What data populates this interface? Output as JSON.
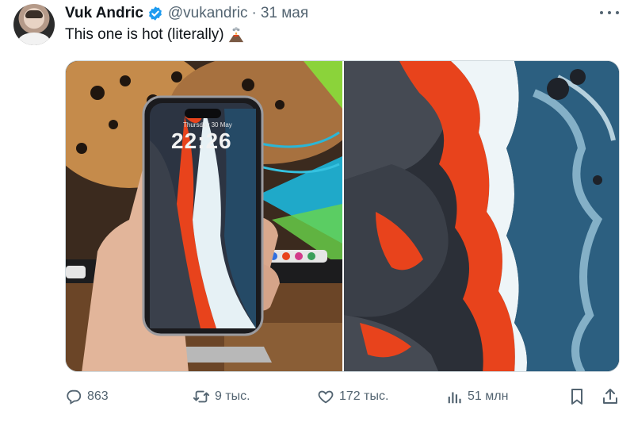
{
  "tweet": {
    "author_name": "Vuk Andric",
    "handle": "@vukandric",
    "separator": "·",
    "date": "31 мая",
    "text": "This one is hot (literally)",
    "emoji_icon": "volcano-icon"
  },
  "stats": {
    "replies": "863",
    "retweets": "9 тыс.",
    "likes": "172 тыс.",
    "views": "51 млн"
  },
  "phone_screen": {
    "date": "Thursday 30 May",
    "time": "22:26"
  },
  "colors": {
    "verified": "#1d9bf0",
    "secondary_text": "#536471",
    "lava": "#e8431c"
  }
}
